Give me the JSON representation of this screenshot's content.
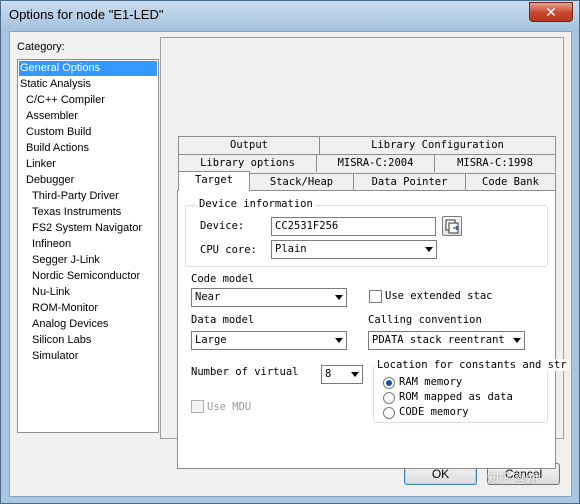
{
  "window": {
    "title": "Options for node \"E1-LED\"",
    "close_glyph": "✕"
  },
  "category": {
    "label": "Category:",
    "items": [
      {
        "label": "General Options"
      },
      {
        "label": "Static Analysis"
      },
      {
        "label": "C/C++ Compiler"
      },
      {
        "label": "Assembler"
      },
      {
        "label": "Custom Build"
      },
      {
        "label": "Build Actions"
      },
      {
        "label": "Linker"
      },
      {
        "label": "Debugger"
      },
      {
        "label": "Third-Party Driver"
      },
      {
        "label": "Texas Instruments"
      },
      {
        "label": "FS2 System Navigator"
      },
      {
        "label": "Infineon"
      },
      {
        "label": "Segger J-Link"
      },
      {
        "label": "Nordic Semiconductor"
      },
      {
        "label": "Nu-Link"
      },
      {
        "label": "ROM-Monitor"
      },
      {
        "label": "Analog Devices"
      },
      {
        "label": "Silicon Labs"
      },
      {
        "label": "Simulator"
      }
    ]
  },
  "tabs": {
    "row1": [
      "Output",
      "Library Configuration"
    ],
    "row2": [
      "Library options",
      "MISRA-C:2004",
      "MISRA-C:1998"
    ],
    "row3": [
      "Target",
      "Stack/Heap",
      "Data Pointer",
      "Code Bank"
    ]
  },
  "target": {
    "device_group_title": "Device information",
    "device_label": "Device:",
    "device_value": "CC2531F256",
    "cpu_label": "CPU core:",
    "cpu_value": "Plain",
    "code_model_label": "Code model",
    "code_model_value": "Near",
    "use_extended_stack_label": "Use extended stac",
    "data_model_label": "Data model",
    "data_model_value": "Large",
    "calling_convention_label": "Calling convention",
    "calling_convention_value": "PDATA stack reentrant",
    "num_virtual_label": "Number of virtual",
    "num_virtual_value": "8",
    "use_mdu_label": "Use MDU",
    "location_group_title": "Location for constants and str",
    "radio_options": [
      "RAM memory",
      "ROM mapped as data",
      "CODE memory"
    ],
    "selected_radio": 0
  },
  "buttons": {
    "ok": "OK",
    "cancel": "Cancel"
  },
  "watermark": "知乎 @zlf",
  "colors": {
    "selection": "#3399ff",
    "radio_dot": "#1a4fa8",
    "close_button": "#c8452c"
  }
}
